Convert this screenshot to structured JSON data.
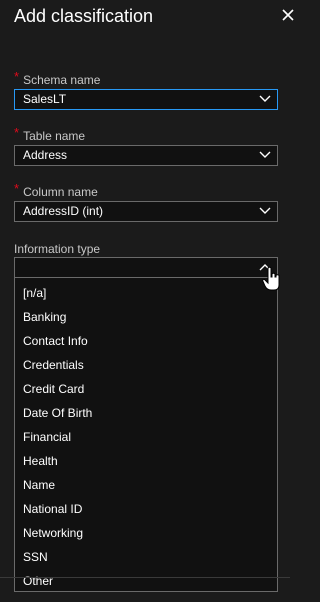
{
  "header": {
    "title": "Add classification"
  },
  "schema": {
    "label": "Schema name",
    "required_mark": "*",
    "value": "SalesLT"
  },
  "table": {
    "label": "Table name",
    "required_mark": "*",
    "value": "Address"
  },
  "column": {
    "label": "Column name",
    "required_mark": "*",
    "value": "AddressID (int)"
  },
  "info_type": {
    "label": "Information type",
    "value": "",
    "options": [
      "[n/a]",
      "Banking",
      "Contact Info",
      "Credentials",
      "Credit Card",
      "Date Of Birth",
      "Financial",
      "Health",
      "Name",
      "National ID",
      "Networking",
      "SSN",
      "Other"
    ]
  },
  "colors": {
    "required": "#e00b1c",
    "focus": "#2899f5",
    "background": "#1b1b1b"
  },
  "icons": {
    "close": "close-icon",
    "chevron": "chevron-down-icon",
    "cursor": "hand-pointer-icon"
  }
}
